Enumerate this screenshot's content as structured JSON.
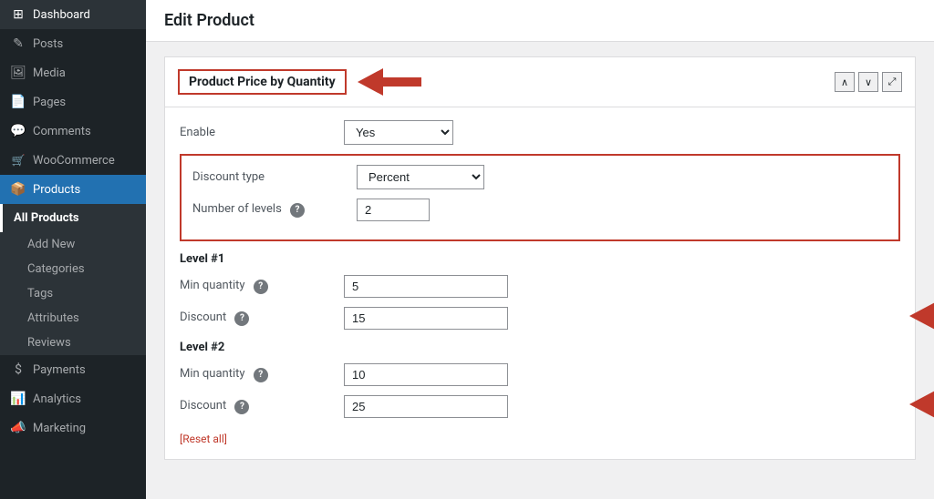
{
  "sidebar": {
    "items": [
      {
        "label": "Dashboard",
        "icon": "⊞",
        "active": false
      },
      {
        "label": "Posts",
        "icon": "✏",
        "active": false
      },
      {
        "label": "Media",
        "icon": "🖼",
        "active": false
      },
      {
        "label": "Pages",
        "icon": "📄",
        "active": false
      },
      {
        "label": "Comments",
        "icon": "💬",
        "active": false
      },
      {
        "label": "WooCommerce",
        "icon": "🛒",
        "active": false
      },
      {
        "label": "Products",
        "icon": "📦",
        "active": true
      },
      {
        "label": "Payments",
        "icon": "$",
        "active": false
      },
      {
        "label": "Analytics",
        "icon": "📊",
        "active": false
      },
      {
        "label": "Marketing",
        "icon": "📣",
        "active": false
      }
    ],
    "products_submenu": [
      {
        "label": "All Products",
        "active": true
      },
      {
        "label": "Add New",
        "active": false
      },
      {
        "label": "Categories",
        "active": false
      },
      {
        "label": "Tags",
        "active": false
      },
      {
        "label": "Attributes",
        "active": false
      },
      {
        "label": "Reviews",
        "active": false
      }
    ]
  },
  "header": {
    "title": "Edit Product"
  },
  "panel": {
    "title": "Product Price by Quantity",
    "enable_label": "Enable",
    "enable_value": "Yes",
    "discount_type_label": "Discount type",
    "discount_type_value": "Percent",
    "num_levels_label": "Number of levels",
    "num_levels_help": "?",
    "num_levels_value": "2",
    "level1_title": "Level #1",
    "level1_min_qty_label": "Min quantity",
    "level1_min_qty_value": "5",
    "level1_discount_label": "Discount",
    "level1_discount_value": "15",
    "level2_title": "Level #2",
    "level2_min_qty_label": "Min quantity",
    "level2_min_qty_value": "10",
    "level2_discount_label": "Discount",
    "level2_discount_value": "25",
    "reset_label": "Reset all"
  },
  "icons": {
    "chevron_up": "∧",
    "chevron_down": "∨",
    "expand": "⤢"
  },
  "colors": {
    "red": "#c0392b",
    "sidebar_active": "#2271b1",
    "sidebar_bg": "#1d2327"
  }
}
